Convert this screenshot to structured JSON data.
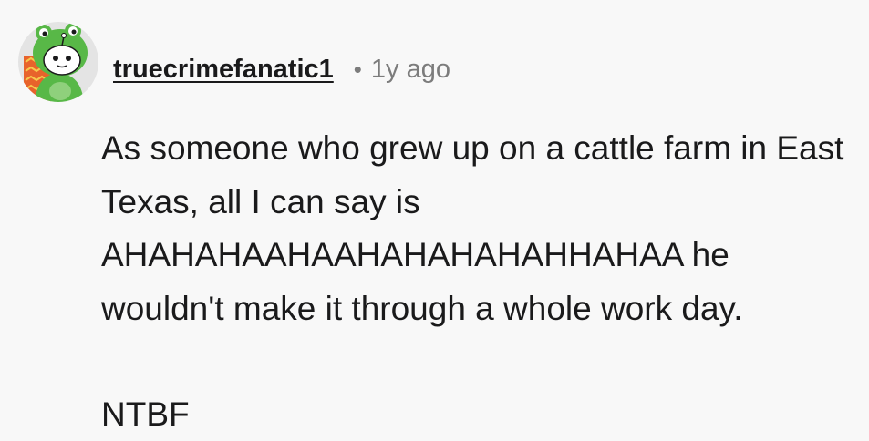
{
  "comment": {
    "username": "truecrimefanatic1",
    "separator": "•",
    "timestamp": "1y ago",
    "avatar_icon": "frog-hood-snoo-avatar",
    "paragraphs": [
      "As someone who grew up on a cattle farm in East Texas, all I can say is AHAHAHAAHAAHAHAHAHAHHAHAA he wouldn't make it through a whole work day.",
      "NTBF"
    ]
  },
  "colors": {
    "background": "#f8f8f8",
    "text": "#1a1a1b",
    "muted": "#7c7c7c",
    "avatar_green": "#4caf50",
    "avatar_orange": "#e8632b"
  }
}
